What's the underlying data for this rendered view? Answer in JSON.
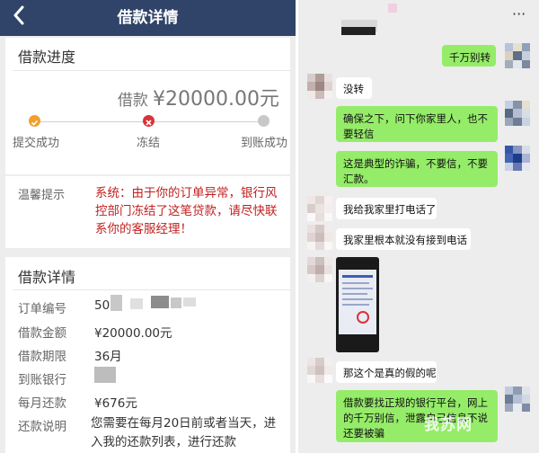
{
  "loan_app": {
    "title": "借款详情",
    "progress": {
      "heading": "借款进度",
      "amount_label": "借款",
      "amount": "¥20000.00元",
      "steps": [
        {
          "label": "提交成功",
          "state": "done",
          "color": "#f0a02b"
        },
        {
          "label": "冻结",
          "state": "error",
          "color": "#d9333a"
        },
        {
          "label": "到账成功",
          "state": "pending",
          "color": "#c8c8c8"
        }
      ]
    },
    "notice": {
      "label": "温馨提示",
      "text": "系统：由于你的订单异常，银行风控部门冻结了这笔贷款，请尽快联系你的客服经理！"
    },
    "details": {
      "heading": "借款详情",
      "rows": [
        {
          "label": "订单编号",
          "value": "50"
        },
        {
          "label": "借款金额",
          "value": "¥20000.00元"
        },
        {
          "label": "借款期限",
          "value": "36月"
        },
        {
          "label": "到账银行",
          "value": ""
        },
        {
          "label": "每月还款",
          "value": "¥676元"
        },
        {
          "label": "还款说明",
          "value": "您需要在每月20日前或者当天，进入我的还款列表，进行还款"
        }
      ]
    }
  },
  "chat": {
    "menu_icon": "···",
    "messages": [
      {
        "side": "right",
        "text": "千万别转"
      },
      {
        "side": "left",
        "text": "没转"
      },
      {
        "side": "right",
        "text": "确保之下，问下你家里人，也不要轻信"
      },
      {
        "side": "right",
        "text": "这是典型的诈骗，不要信，不要汇款。"
      },
      {
        "side": "left",
        "text": "我给我家里打电话了"
      },
      {
        "side": "left",
        "text": "我家里根本就没有接到电话"
      },
      {
        "side": "left",
        "text": "",
        "type": "image"
      },
      {
        "side": "left",
        "text": "那这个是真的假的呢"
      },
      {
        "side": "right",
        "text": "借款要找正规的银行平台，网上的千万别信，泄露自己信息不说还要被骗"
      }
    ],
    "watermark": "我苏网"
  },
  "colors": {
    "header_bg": "#2f4468",
    "alert_red": "#c0201f",
    "wechat_green": "#95ec69"
  }
}
